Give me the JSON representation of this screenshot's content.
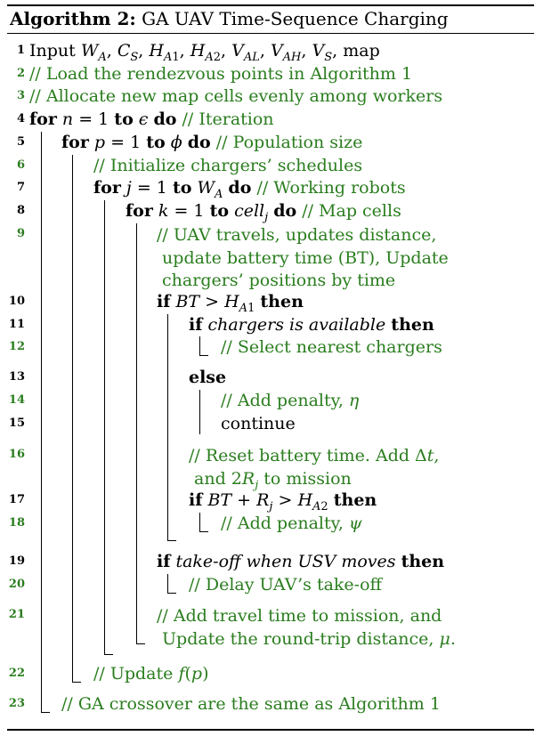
{
  "caption": {
    "label": "Algorithm 2:",
    "title": "GA UAV Time-Sequence Charging"
  },
  "lines": [
    {
      "no": "1",
      "text": "Input W_A, C_S, H_A1, H_A2, V_AL, V_AH, V_S, map"
    },
    {
      "no": "2",
      "text": "// Load the rendezvous points in Algorithm 1"
    },
    {
      "no": "3",
      "text": "// Allocate new map cells evenly among workers"
    },
    {
      "no": "4",
      "text": "for n = 1 to ϵ do // Iteration"
    },
    {
      "no": "5",
      "text": "for p = 1 to ϕ do // Population size"
    },
    {
      "no": "6",
      "text": "// Initialize chargers’ schedules"
    },
    {
      "no": "7",
      "text": "for j = 1 to W_A do // Working robots"
    },
    {
      "no": "8",
      "text": "for k = 1 to cell_j do // Map cells"
    },
    {
      "no": "9",
      "text": "// UAV travels, updates distance, update battery time (BT), Update chargers’ positions by time"
    },
    {
      "no": "10",
      "text": "if BT > H_A1 then"
    },
    {
      "no": "11",
      "text": "if chargers is available then"
    },
    {
      "no": "12",
      "text": "// Select nearest chargers"
    },
    {
      "no": "13",
      "text": "else"
    },
    {
      "no": "14",
      "text": "// Add penalty, η"
    },
    {
      "no": "15",
      "text": "continue"
    },
    {
      "no": "16",
      "text": "// Reset battery time. Add Δt, and 2R_j to mission"
    },
    {
      "no": "17",
      "text": "if BT + R_j > H_A2 then"
    },
    {
      "no": "18",
      "text": "// Add penalty, ψ"
    },
    {
      "no": "19",
      "text": "if take-off when USV moves then"
    },
    {
      "no": "20",
      "text": "// Delay UAV’s take-off"
    },
    {
      "no": "21",
      "text": "// Add travel time to mission, and Update the round-trip distance, μ."
    },
    {
      "no": "22",
      "text": "// Update f(p)"
    },
    {
      "no": "23",
      "text": "// GA crossover are the same as Algorithm 1"
    }
  ],
  "colors": {
    "comment": "#2a7d1e",
    "text": "#000000"
  }
}
